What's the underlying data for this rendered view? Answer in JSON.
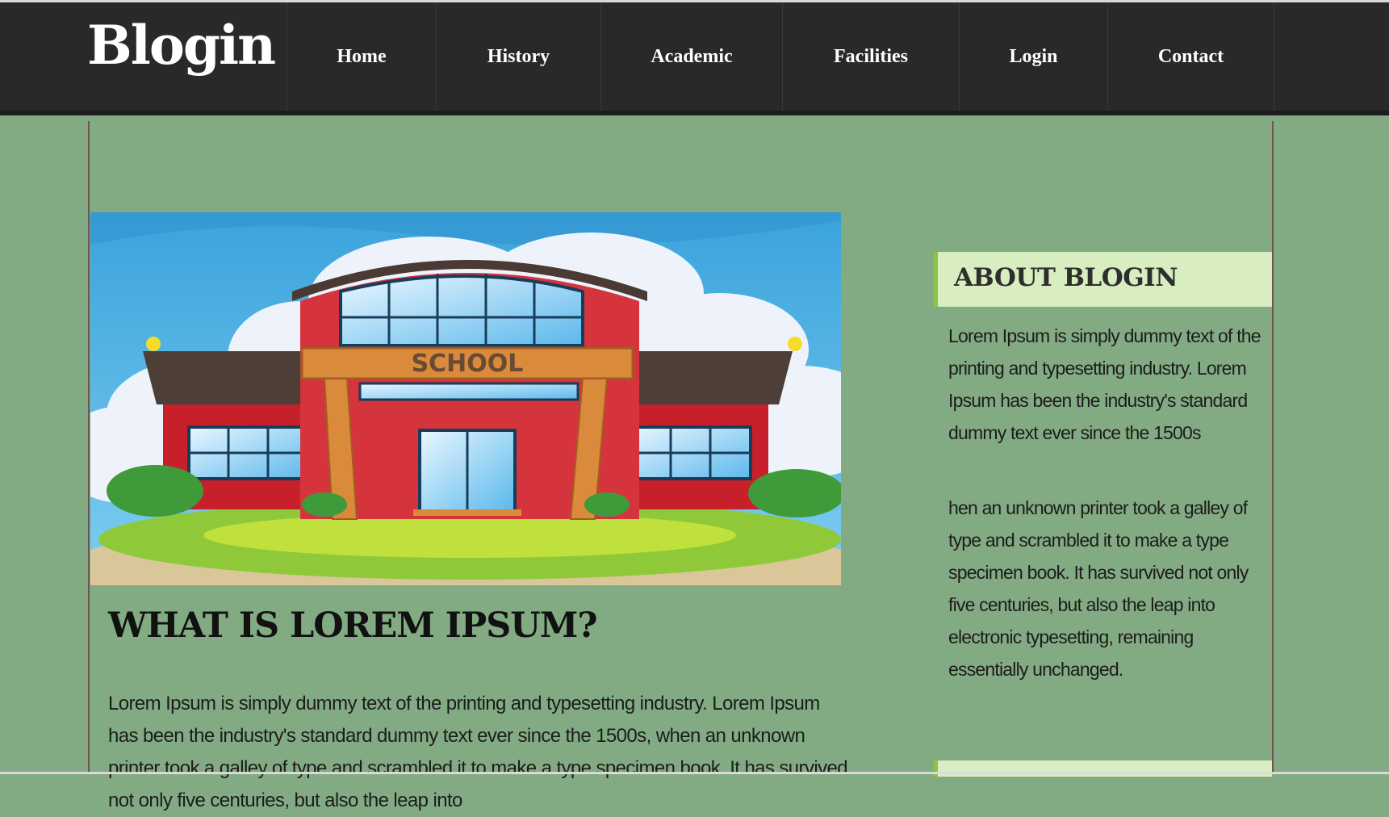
{
  "brand": {
    "title": "Blogin"
  },
  "nav": {
    "items": [
      {
        "label": "Home"
      },
      {
        "label": "History"
      },
      {
        "label": "Academic"
      },
      {
        "label": "Facilities"
      },
      {
        "label": "Login"
      },
      {
        "label": "Contact"
      }
    ]
  },
  "hero": {
    "sign_text": "SCHOOL"
  },
  "post": {
    "title": "WHAT IS LOREM IPSUM?",
    "body": "Lorem Ipsum is simply dummy text of the printing and typesetting industry. Lorem Ipsum has been the industry's standard dummy text ever since the 1500s, when an unknown printer took a galley of type and scrambled it to make a type specimen book. It has survived not only five centuries, but also the leap into"
  },
  "sidebar": {
    "title": "ABOUT BLOGIN",
    "para1": "Lorem Ipsum is simply dummy text of the printing and typesetting industry. Lorem Ipsum has been the industry's standard dummy text ever since the 1500s",
    "para2": "hen an unknown printer took a galley of type and scrambled it to make a type specimen book. It has survived not only five centuries, but also the leap into electronic typesetting, remaining essentially unchanged."
  },
  "colors": {
    "page_bg": "#83ab83",
    "nav_bg": "#292929",
    "sidebar_head_bg": "#d8eec0",
    "sidebar_accent": "#8cc34b"
  }
}
